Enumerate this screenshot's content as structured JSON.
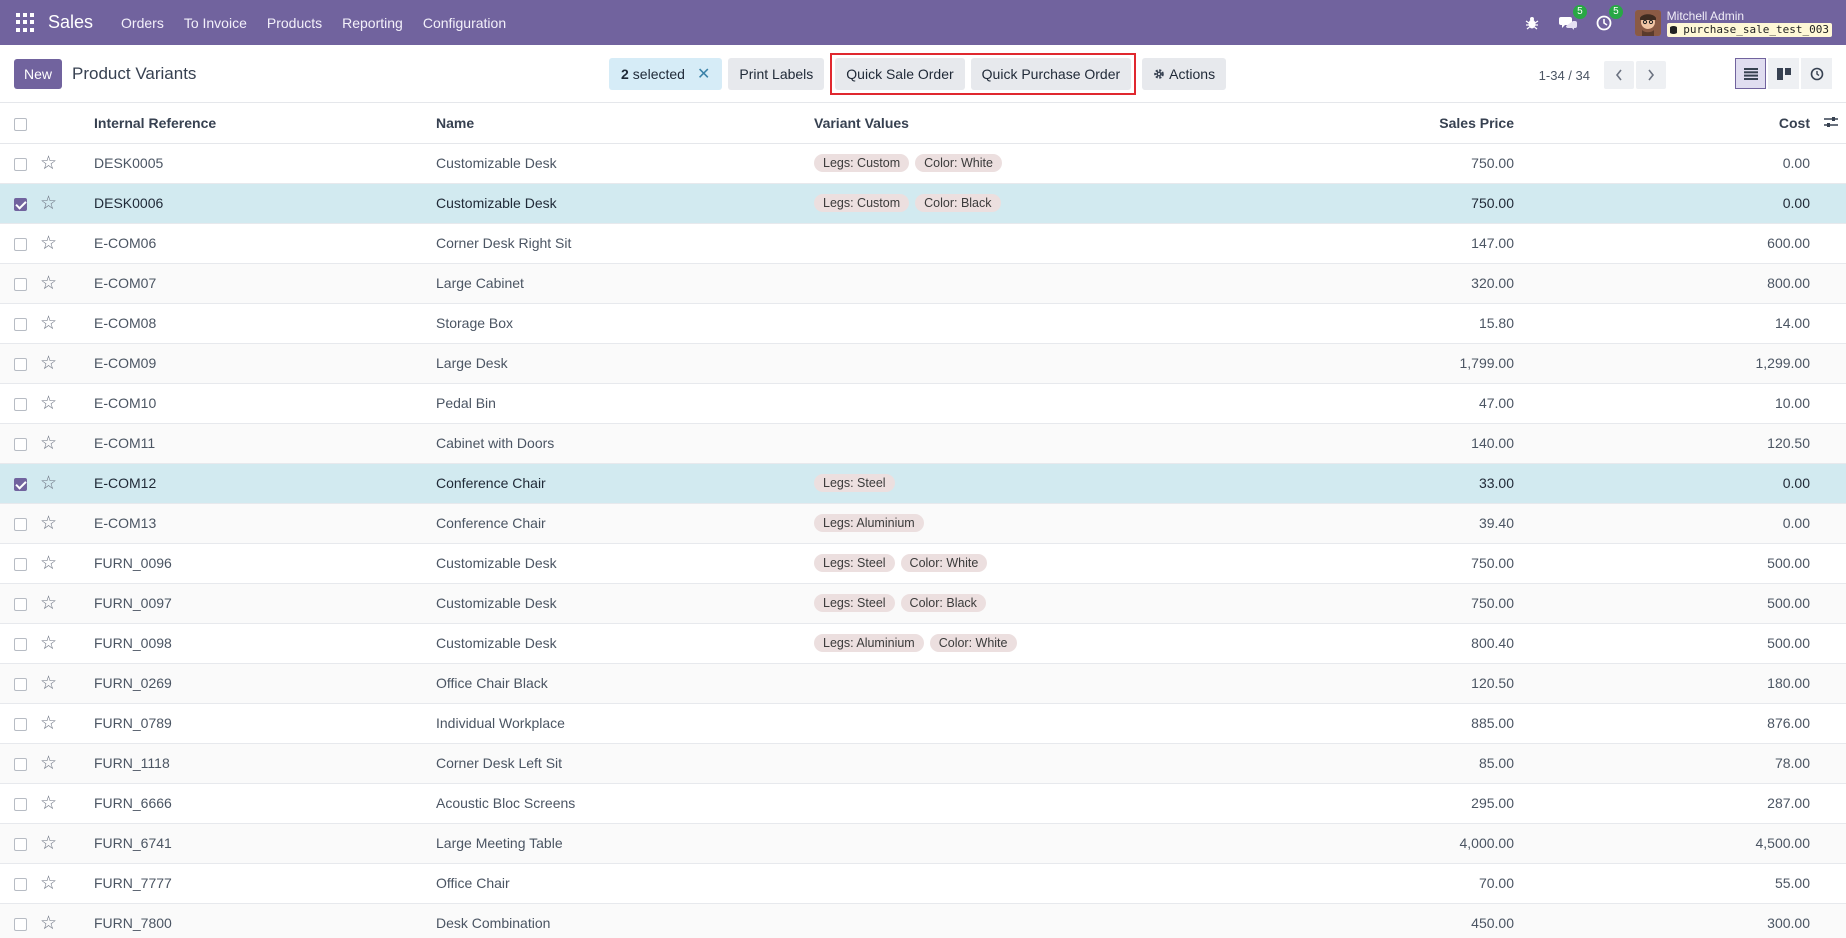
{
  "navbar": {
    "app_name": "Sales",
    "menu": [
      "Orders",
      "To Invoice",
      "Products",
      "Reporting",
      "Configuration"
    ],
    "messages_badge": "5",
    "activities_badge": "5",
    "user_name": "Mitchell Admin",
    "database": "purchase_sale_test_003"
  },
  "control": {
    "new_label": "New",
    "title": "Product Variants",
    "selected_count": "2",
    "selected_label": "selected",
    "print_labels": "Print Labels",
    "quick_sale_order": "Quick Sale Order",
    "quick_purchase_order": "Quick Purchase Order",
    "actions": "Actions",
    "pager": "1-34 / 34"
  },
  "table": {
    "headers": {
      "ref": "Internal Reference",
      "name": "Name",
      "variants": "Variant Values",
      "price": "Sales Price",
      "cost": "Cost"
    },
    "rows": [
      {
        "ref": "DESK0005",
        "name": "Customizable Desk",
        "tags": [
          "Legs: Custom",
          "Color: White"
        ],
        "price": "750.00",
        "cost": "0.00",
        "selected": false
      },
      {
        "ref": "DESK0006",
        "name": "Customizable Desk",
        "tags": [
          "Legs: Custom",
          "Color: Black"
        ],
        "price": "750.00",
        "cost": "0.00",
        "selected": true
      },
      {
        "ref": "E-COM06",
        "name": "Corner Desk Right Sit",
        "tags": [],
        "price": "147.00",
        "cost": "600.00",
        "selected": false
      },
      {
        "ref": "E-COM07",
        "name": "Large Cabinet",
        "tags": [],
        "price": "320.00",
        "cost": "800.00",
        "selected": false
      },
      {
        "ref": "E-COM08",
        "name": "Storage Box",
        "tags": [],
        "price": "15.80",
        "cost": "14.00",
        "selected": false
      },
      {
        "ref": "E-COM09",
        "name": "Large Desk",
        "tags": [],
        "price": "1,799.00",
        "cost": "1,299.00",
        "selected": false
      },
      {
        "ref": "E-COM10",
        "name": "Pedal Bin",
        "tags": [],
        "price": "47.00",
        "cost": "10.00",
        "selected": false
      },
      {
        "ref": "E-COM11",
        "name": "Cabinet with Doors",
        "tags": [],
        "price": "140.00",
        "cost": "120.50",
        "selected": false
      },
      {
        "ref": "E-COM12",
        "name": "Conference Chair",
        "tags": [
          "Legs: Steel"
        ],
        "price": "33.00",
        "cost": "0.00",
        "selected": true
      },
      {
        "ref": "E-COM13",
        "name": "Conference Chair",
        "tags": [
          "Legs: Aluminium"
        ],
        "price": "39.40",
        "cost": "0.00",
        "selected": false
      },
      {
        "ref": "FURN_0096",
        "name": "Customizable Desk",
        "tags": [
          "Legs: Steel",
          "Color: White"
        ],
        "price": "750.00",
        "cost": "500.00",
        "selected": false
      },
      {
        "ref": "FURN_0097",
        "name": "Customizable Desk",
        "tags": [
          "Legs: Steel",
          "Color: Black"
        ],
        "price": "750.00",
        "cost": "500.00",
        "selected": false
      },
      {
        "ref": "FURN_0098",
        "name": "Customizable Desk",
        "tags": [
          "Legs: Aluminium",
          "Color: White"
        ],
        "price": "800.40",
        "cost": "500.00",
        "selected": false
      },
      {
        "ref": "FURN_0269",
        "name": "Office Chair Black",
        "tags": [],
        "price": "120.50",
        "cost": "180.00",
        "selected": false
      },
      {
        "ref": "FURN_0789",
        "name": "Individual Workplace",
        "tags": [],
        "price": "885.00",
        "cost": "876.00",
        "selected": false
      },
      {
        "ref": "FURN_1118",
        "name": "Corner Desk Left Sit",
        "tags": [],
        "price": "85.00",
        "cost": "78.00",
        "selected": false
      },
      {
        "ref": "FURN_6666",
        "name": "Acoustic Bloc Screens",
        "tags": [],
        "price": "295.00",
        "cost": "287.00",
        "selected": false
      },
      {
        "ref": "FURN_6741",
        "name": "Large Meeting Table",
        "tags": [],
        "price": "4,000.00",
        "cost": "4,500.00",
        "selected": false
      },
      {
        "ref": "FURN_7777",
        "name": "Office Chair",
        "tags": [],
        "price": "70.00",
        "cost": "55.00",
        "selected": false
      },
      {
        "ref": "FURN_7800",
        "name": "Desk Combination",
        "tags": [],
        "price": "450.00",
        "cost": "300.00",
        "selected": false
      }
    ]
  },
  "colors": {
    "brand": "#71639e",
    "selected_row": "#d2eaf0",
    "highlight_border": "#e0282f"
  }
}
